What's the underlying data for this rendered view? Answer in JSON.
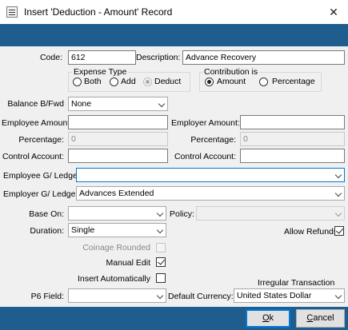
{
  "window": {
    "title": "Insert 'Deduction - Amount' Record",
    "close_glyph": "✕"
  },
  "form": {
    "code": {
      "label": "Code:",
      "value": "612"
    },
    "description": {
      "label": "Description:",
      "value": "Advance Recovery"
    },
    "expense_type": {
      "label": "Expense Type",
      "options": [
        {
          "label": "Both",
          "selected": false
        },
        {
          "label": "Add",
          "selected": false
        },
        {
          "label": "Deduct",
          "selected": true
        }
      ]
    },
    "contribution": {
      "label": "Contribution is",
      "options": [
        {
          "label": "Amount",
          "selected": true
        },
        {
          "label": "Percentage",
          "selected": false
        }
      ]
    },
    "balance_bfwd": {
      "label": "Balance B/Fwd",
      "value": "None"
    },
    "employee_amount": {
      "label": "Employee Amount:",
      "value": ""
    },
    "employer_amount": {
      "label": "Employer Amount:",
      "value": ""
    },
    "employee_percentage": {
      "label": "Percentage:",
      "value": "0"
    },
    "employer_percentage": {
      "label": "Percentage:",
      "value": "0"
    },
    "employee_control_account": {
      "label": "Control Account:",
      "value": ""
    },
    "employer_control_account": {
      "label": "Control Account:",
      "value": ""
    },
    "employee_gl": {
      "label": "Employee G/ Ledger:",
      "value": ""
    },
    "employer_gl": {
      "label": "Employer G/ Ledger:",
      "value": "Advances Extended"
    },
    "base_on": {
      "label": "Base On:",
      "value": ""
    },
    "policy": {
      "label": "Policy:",
      "value": ""
    },
    "duration": {
      "label": "Duration:",
      "value": "Single"
    },
    "allow_refunds": {
      "label": "Allow Refunds",
      "checked": true
    },
    "coinage_rounded": {
      "label": "Coinage Rounded",
      "checked": false
    },
    "manual_edit": {
      "label": "Manual Edit",
      "checked": true
    },
    "insert_automatically": {
      "label": "Insert Automatically",
      "checked": false
    },
    "p6_field": {
      "label": "P6 Field:",
      "value": ""
    },
    "irregular_transaction": {
      "label": "Irregular Transaction"
    },
    "default_currency": {
      "label": "Default Currency:",
      "value": "United States Dollar"
    }
  },
  "buttons": {
    "ok": {
      "label": "Ok",
      "mnemonic": "O",
      "rest": "k"
    },
    "cancel": {
      "label": "Cancel",
      "mnemonic": "C",
      "rest": "ancel"
    }
  },
  "icons": [
    "window-app-icon",
    "close-icon",
    "chevron-down-icon",
    "checkmark-icon"
  ],
  "colors": {
    "band": "#1f5d8f",
    "form_bg": "#f0f0f0",
    "focus_border": "#0078d7"
  }
}
